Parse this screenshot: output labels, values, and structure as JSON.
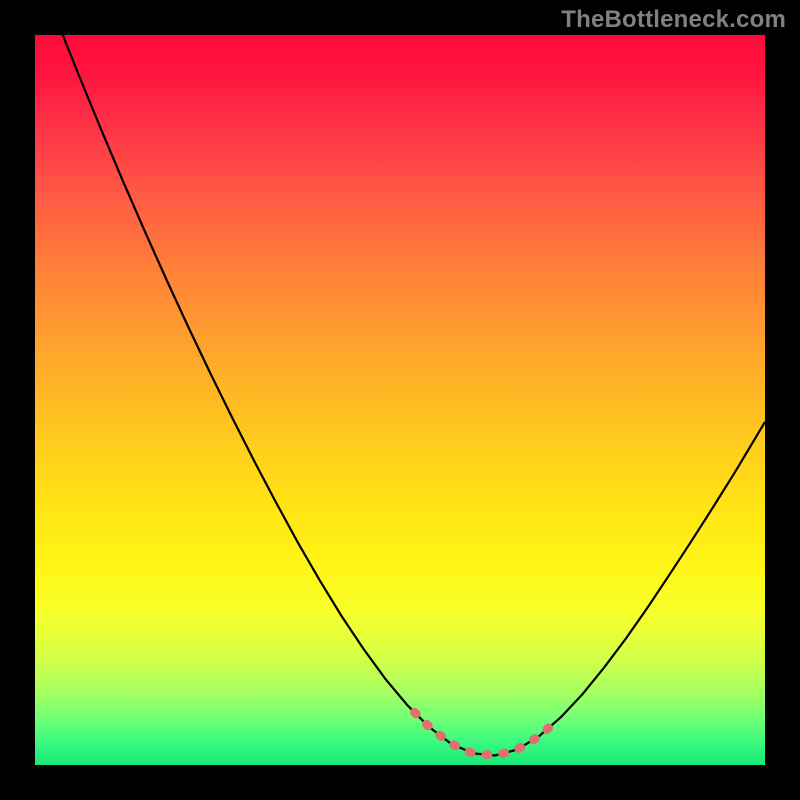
{
  "watermark": "TheBottleneck.com",
  "colors": {
    "page_bg": "#000000",
    "curve": "#000000",
    "highlight": "#e07070",
    "watermark": "#808080",
    "gradient_top": "#ff0a3a",
    "gradient_bottom": "#17e876"
  },
  "chart_data": {
    "type": "line",
    "title": "",
    "xlabel": "",
    "ylabel": "",
    "xlim": [
      0,
      100
    ],
    "ylim": [
      0,
      100
    ],
    "grid": false,
    "legend": false,
    "x": [
      0,
      3,
      6,
      9,
      12,
      15,
      18,
      21,
      24,
      27,
      30,
      33,
      36,
      39,
      42,
      45,
      48,
      51,
      54,
      57,
      60,
      63,
      66,
      69,
      72,
      75,
      78,
      81,
      84,
      87,
      90,
      93,
      96,
      100
    ],
    "y": [
      110,
      102,
      94.5,
      87.2,
      80.1,
      73.2,
      66.5,
      60,
      53.7,
      47.6,
      41.7,
      36,
      30.5,
      25.3,
      20.4,
      15.9,
      11.8,
      8.2,
      5.2,
      2.9,
      1.6,
      1.3,
      2.1,
      3.9,
      6.5,
      9.7,
      13.4,
      17.4,
      21.7,
      26.2,
      30.8,
      35.5,
      40.3,
      47
    ],
    "highlight_x_range": [
      52,
      71
    ],
    "background": "vertical-gradient",
    "notes": "V-shaped bottleneck curve; minimum sits around x≈62, y≈1. Pink dashed highlight marks the optimal zone near the trough."
  }
}
